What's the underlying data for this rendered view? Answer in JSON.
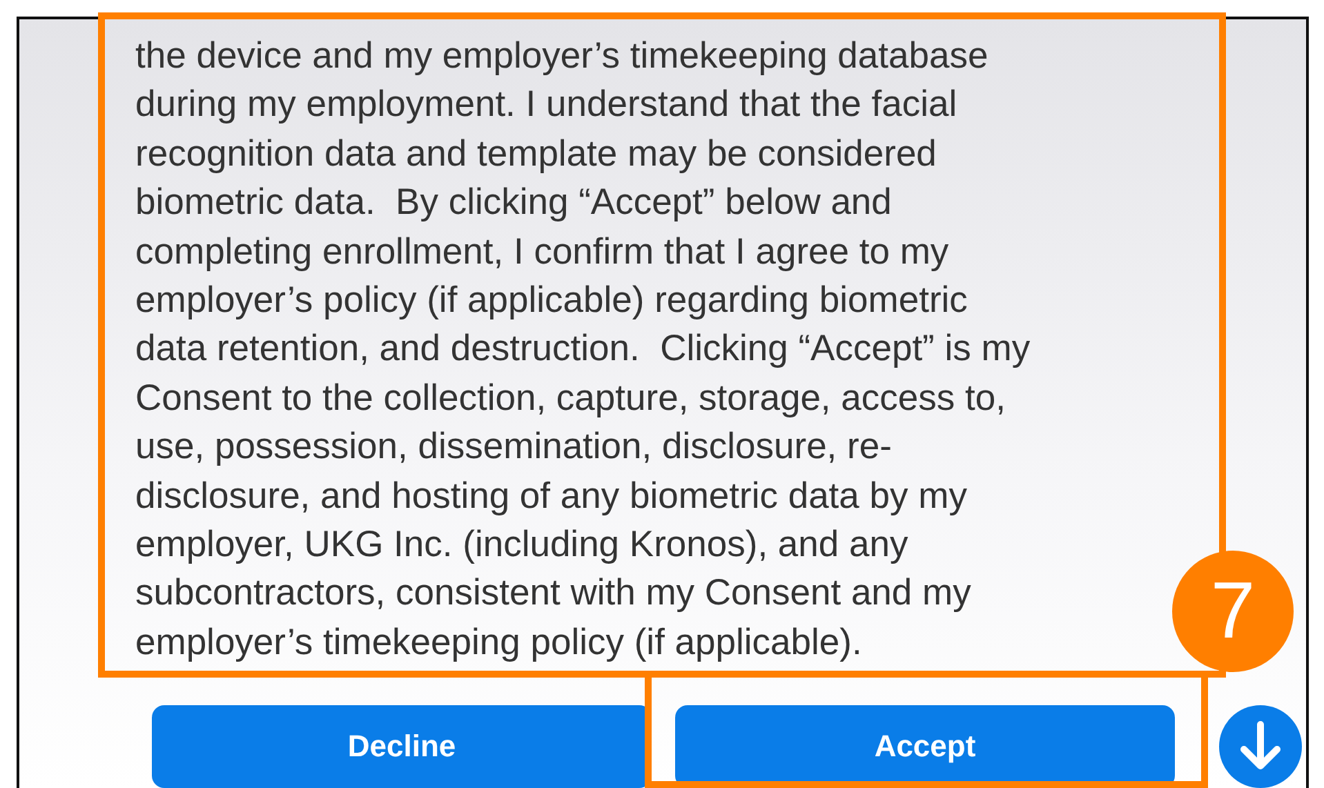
{
  "consent_text": {
    "lines": [
      "the device and my employer’s timekeeping database",
      "during my employment. I understand that the facial",
      "recognition data and template may be considered",
      "biometric data.  By clicking “Accept” below and",
      "completing enrollment, I confirm that I agree to my",
      "employer’s policy (if applicable) regarding biometric",
      "data retention, and destruction.  Clicking “Accept” is my",
      "Consent to the collection, capture, storage, access to,",
      "use, possession, dissemination, disclosure, re-",
      "disclosure, and hosting of any biometric data by my",
      "employer, UKG Inc. (including Kronos), and any",
      "subcontractors, consistent with my Consent and my",
      "employer’s timekeeping policy (if applicable)."
    ]
  },
  "buttons": [
    {
      "label": "Decline"
    },
    {
      "label": "Accept"
    }
  ],
  "scroll_down_button": {
    "kind": "arrow-down"
  },
  "callout": {
    "label": "7"
  }
}
